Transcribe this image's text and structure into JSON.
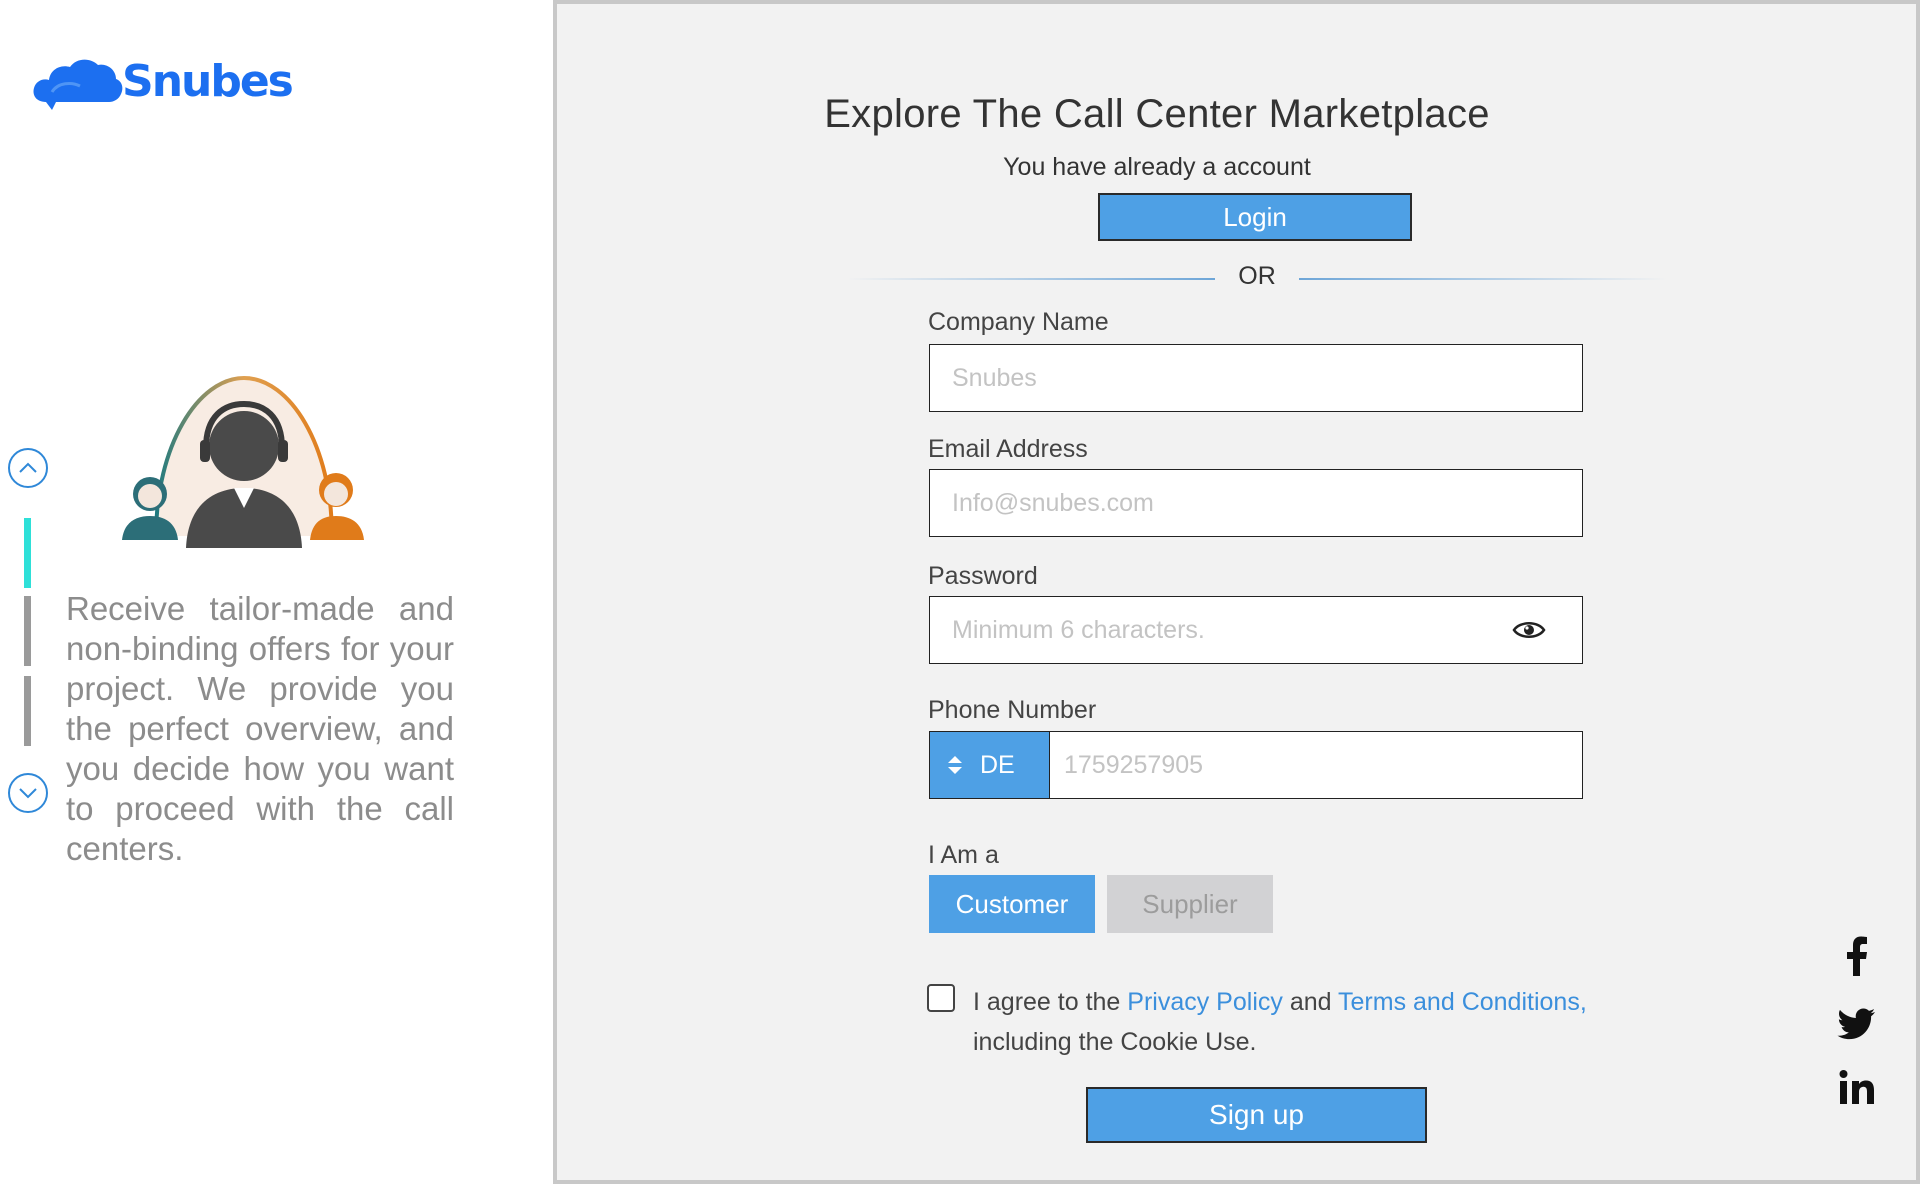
{
  "brand": {
    "name": "Snubes",
    "color": "#1c6ff0"
  },
  "slider": {
    "text": "Receive tailor-made and non-binding offers for your project. We provide you the perfect overview, and you decide how you want to proceed with the call centers.",
    "up_icon": "chevron-up-icon",
    "down_icon": "chevron-down-icon"
  },
  "form": {
    "title": "Explore The Call Center Marketplace",
    "already_account": "You have already a account",
    "login_label": "Login",
    "or_label": "OR",
    "company": {
      "label": "Company Name",
      "placeholder": "Snubes",
      "value": ""
    },
    "email": {
      "label": "Email Address",
      "placeholder": "Info@snubes.com",
      "value": ""
    },
    "password": {
      "label": "Password",
      "placeholder": "Minimum 6 characters.",
      "value": "",
      "toggle_icon": "eye-icon"
    },
    "phone": {
      "label": "Phone Number",
      "country": "DE",
      "placeholder": "1759257905",
      "value": ""
    },
    "role": {
      "label": "I Am a",
      "options": [
        "Customer",
        "Supplier"
      ],
      "selected": "Customer"
    },
    "agree": {
      "prefix": "I agree to the ",
      "privacy": "Privacy Policy",
      "and": " and ",
      "terms": "Terms and Conditions,",
      "suffix": " including the Cookie Use.",
      "checked": false
    },
    "signup_label": "Sign up"
  },
  "social": [
    "facebook-icon",
    "twitter-icon",
    "linkedin-icon"
  ],
  "colors": {
    "accent": "#4ea0e5",
    "link": "#3b8fdc",
    "active_bar": "#2ee0d8"
  }
}
